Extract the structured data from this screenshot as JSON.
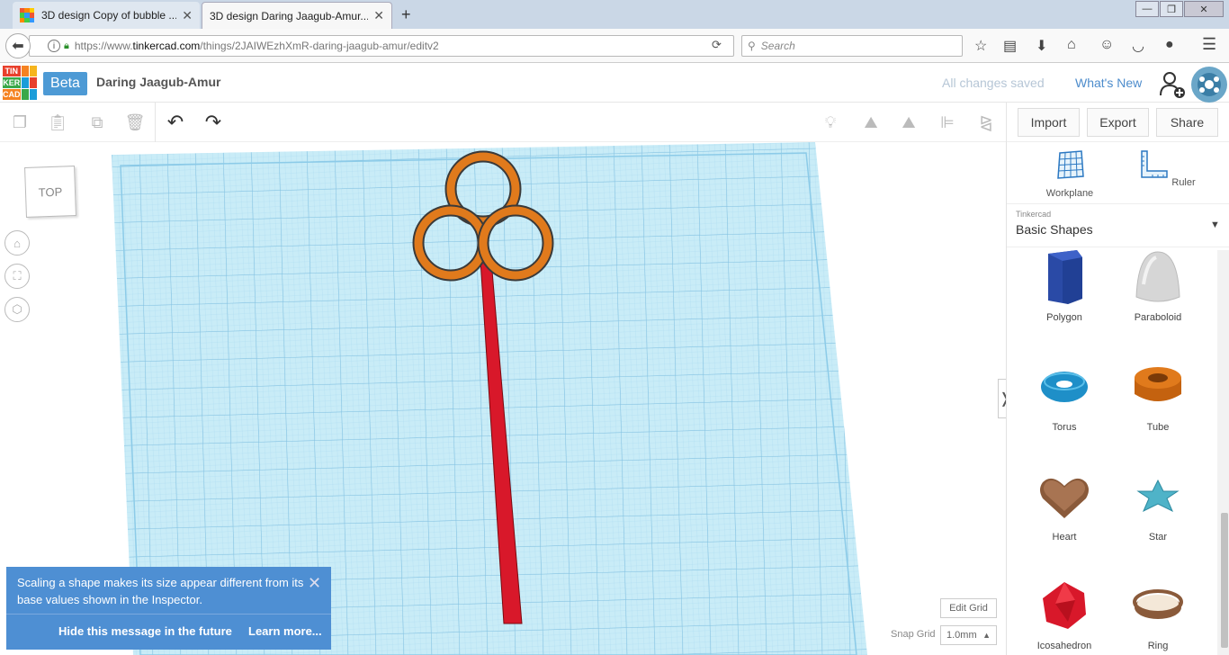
{
  "browser": {
    "tabs": [
      {
        "title": "3D design Copy of bubble ...",
        "active": false
      },
      {
        "title": "3D design Daring Jaagub-Amur...",
        "active": true
      }
    ],
    "url_prefix": "https://www.",
    "url_host": "tinkercad.com",
    "url_path": "/things/2JAIWEzhXmR-daring-jaagub-amur/editv2",
    "search_placeholder": "Search"
  },
  "app": {
    "logo_letters": [
      "TIN",
      "KER",
      "CAD"
    ],
    "beta_label": "Beta",
    "design_name": "Daring Jaagub-Amur",
    "save_status": "All changes saved",
    "whats_new": "What's New"
  },
  "toolbar": {
    "import_label": "Import",
    "export_label": "Export",
    "share_label": "Share"
  },
  "viewport": {
    "view_cube_label": "TOP",
    "edit_grid_label": "Edit Grid",
    "snap_grid_label": "Snap Grid",
    "snap_grid_value": "1.0mm"
  },
  "toast": {
    "message": "Scaling a shape makes its size appear different from its base values shown in the Inspector.",
    "hide_label": "Hide this message in the future",
    "learn_label": "Learn more..."
  },
  "panel": {
    "workplane_label": "Workplane",
    "ruler_label": "Ruler",
    "provider": "Tinkercad",
    "category": "Basic Shapes",
    "shapes": [
      {
        "name": "Polygon",
        "icon": "polygon-icon",
        "color": "#2a4aa6"
      },
      {
        "name": "Paraboloid",
        "icon": "paraboloid-icon",
        "color": "#d6d6d6"
      },
      {
        "name": "Torus",
        "icon": "torus-icon",
        "color": "#1e8fc8"
      },
      {
        "name": "Tube",
        "icon": "tube-icon",
        "color": "#e07a1c"
      },
      {
        "name": "Heart",
        "icon": "heart-icon",
        "color": "#8a5a3a"
      },
      {
        "name": "Star",
        "icon": "star-icon",
        "color": "#4fb3c8"
      },
      {
        "name": "Icosahedron",
        "icon": "icosahedron-icon",
        "color": "#d8182a"
      },
      {
        "name": "Ring",
        "icon": "ring-icon",
        "color": "#8a5a3a"
      }
    ]
  },
  "colors": {
    "accent": "#4e8fd3",
    "workplane": "#c9ecf7",
    "rings": "#e07a1c",
    "handle": "#d8182a"
  }
}
